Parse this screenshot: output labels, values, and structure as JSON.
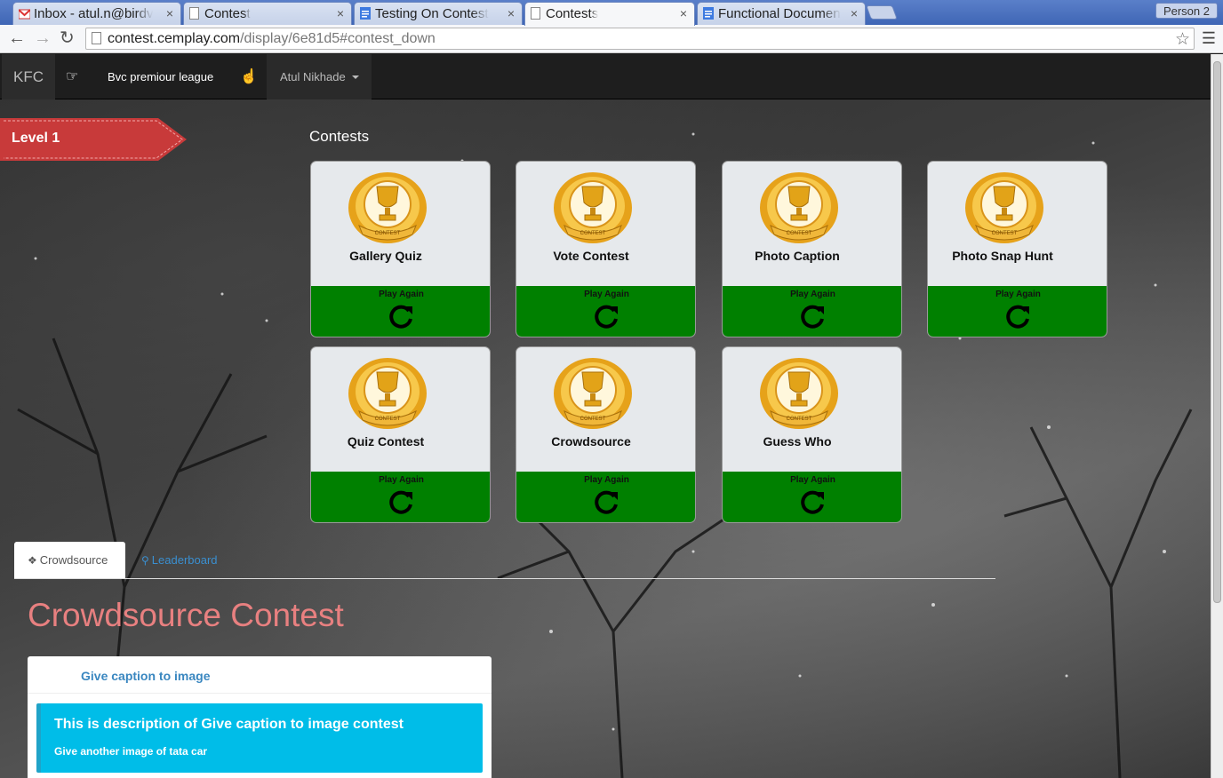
{
  "browser": {
    "tabs": [
      {
        "title": "Inbox - atul.n@birdv",
        "icon": "gmail-icon"
      },
      {
        "title": "Contest",
        "icon": "page-icon"
      },
      {
        "title": "Testing On Contest",
        "icon": "doc-icon"
      },
      {
        "title": "Contests",
        "icon": "page-icon",
        "active": true
      },
      {
        "title": "Functional Documen",
        "icon": "doc-icon"
      }
    ],
    "close_glyph": "×",
    "person": "Person 2",
    "url_host": "contest.cemplay.com",
    "url_path": "/display/6e81d5#contest_down"
  },
  "nav": {
    "brand": "KFC",
    "league": "Bvc premiour league",
    "user": "Atul Nikhade"
  },
  "level": {
    "label": "Level 1"
  },
  "contests": {
    "title": "Contests",
    "play_label": "Play Again",
    "items": [
      {
        "name": "Gallery Quiz"
      },
      {
        "name": "Vote Contest"
      },
      {
        "name": "Photo Caption"
      },
      {
        "name": "Photo Snap Hunt"
      },
      {
        "name": "Quiz Contest"
      },
      {
        "name": "Crowdsource"
      },
      {
        "name": "Guess Who"
      }
    ],
    "trophy_text": "CONTEST"
  },
  "tabs": {
    "crowdsource": "Crowdsource",
    "leaderboard": "Leaderboard"
  },
  "section": {
    "heading": "Crowdsource Contest",
    "panel_link": "Give caption to image",
    "info_title": "This is description of Give caption to image contest",
    "info_sub": "Give another image of tata car"
  },
  "colors": {
    "play_green": "#008000",
    "heading_salmon": "#e88080",
    "info_cyan": "#00bde8",
    "level_red": "#c83a3a"
  }
}
